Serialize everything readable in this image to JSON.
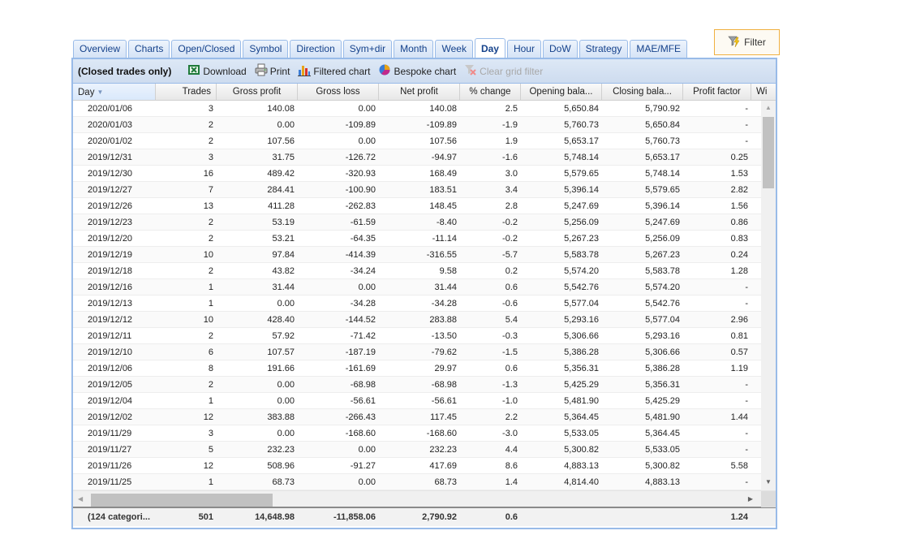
{
  "filter_button": {
    "label": "Filter",
    "icon": "funnel-lightning-icon"
  },
  "tabs": [
    {
      "label": "Overview",
      "active": false
    },
    {
      "label": "Charts",
      "active": false
    },
    {
      "label": "Open/Closed",
      "active": false
    },
    {
      "label": "Symbol",
      "active": false
    },
    {
      "label": "Direction",
      "active": false
    },
    {
      "label": "Sym+dir",
      "active": false
    },
    {
      "label": "Month",
      "active": false
    },
    {
      "label": "Week",
      "active": false
    },
    {
      "label": "Day",
      "active": true
    },
    {
      "label": "Hour",
      "active": false
    },
    {
      "label": "DoW",
      "active": false
    },
    {
      "label": "Strategy",
      "active": false
    },
    {
      "label": "MAE/MFE",
      "active": false
    }
  ],
  "toolbar": {
    "title": "(Closed trades only)",
    "download": "Download",
    "print": "Print",
    "filtered_chart": "Filtered chart",
    "bespoke_chart": "Bespoke chart",
    "clear_filter": "Clear grid filter"
  },
  "columns": [
    "Day",
    "Trades",
    "Gross profit",
    "Gross loss",
    "Net profit",
    "% change",
    "Opening bala...",
    "Closing bala...",
    "Profit factor",
    "Wi"
  ],
  "sort": {
    "column": "Day",
    "direction": "desc"
  },
  "rows": [
    [
      "2020/01/06",
      "3",
      "140.08",
      "0.00",
      "140.08",
      "2.5",
      "5,650.84",
      "5,790.92",
      "-"
    ],
    [
      "2020/01/03",
      "2",
      "0.00",
      "-109.89",
      "-109.89",
      "-1.9",
      "5,760.73",
      "5,650.84",
      "-"
    ],
    [
      "2020/01/02",
      "2",
      "107.56",
      "0.00",
      "107.56",
      "1.9",
      "5,653.17",
      "5,760.73",
      "-"
    ],
    [
      "2019/12/31",
      "3",
      "31.75",
      "-126.72",
      "-94.97",
      "-1.6",
      "5,748.14",
      "5,653.17",
      "0.25"
    ],
    [
      "2019/12/30",
      "16",
      "489.42",
      "-320.93",
      "168.49",
      "3.0",
      "5,579.65",
      "5,748.14",
      "1.53"
    ],
    [
      "2019/12/27",
      "7",
      "284.41",
      "-100.90",
      "183.51",
      "3.4",
      "5,396.14",
      "5,579.65",
      "2.82"
    ],
    [
      "2019/12/26",
      "13",
      "411.28",
      "-262.83",
      "148.45",
      "2.8",
      "5,247.69",
      "5,396.14",
      "1.56"
    ],
    [
      "2019/12/23",
      "2",
      "53.19",
      "-61.59",
      "-8.40",
      "-0.2",
      "5,256.09",
      "5,247.69",
      "0.86"
    ],
    [
      "2019/12/20",
      "2",
      "53.21",
      "-64.35",
      "-11.14",
      "-0.2",
      "5,267.23",
      "5,256.09",
      "0.83"
    ],
    [
      "2019/12/19",
      "10",
      "97.84",
      "-414.39",
      "-316.55",
      "-5.7",
      "5,583.78",
      "5,267.23",
      "0.24"
    ],
    [
      "2019/12/18",
      "2",
      "43.82",
      "-34.24",
      "9.58",
      "0.2",
      "5,574.20",
      "5,583.78",
      "1.28"
    ],
    [
      "2019/12/16",
      "1",
      "31.44",
      "0.00",
      "31.44",
      "0.6",
      "5,542.76",
      "5,574.20",
      "-"
    ],
    [
      "2019/12/13",
      "1",
      "0.00",
      "-34.28",
      "-34.28",
      "-0.6",
      "5,577.04",
      "5,542.76",
      "-"
    ],
    [
      "2019/12/12",
      "10",
      "428.40",
      "-144.52",
      "283.88",
      "5.4",
      "5,293.16",
      "5,577.04",
      "2.96"
    ],
    [
      "2019/12/11",
      "2",
      "57.92",
      "-71.42",
      "-13.50",
      "-0.3",
      "5,306.66",
      "5,293.16",
      "0.81"
    ],
    [
      "2019/12/10",
      "6",
      "107.57",
      "-187.19",
      "-79.62",
      "-1.5",
      "5,386.28",
      "5,306.66",
      "0.57"
    ],
    [
      "2019/12/06",
      "8",
      "191.66",
      "-161.69",
      "29.97",
      "0.6",
      "5,356.31",
      "5,386.28",
      "1.19"
    ],
    [
      "2019/12/05",
      "2",
      "0.00",
      "-68.98",
      "-68.98",
      "-1.3",
      "5,425.29",
      "5,356.31",
      "-"
    ],
    [
      "2019/12/04",
      "1",
      "0.00",
      "-56.61",
      "-56.61",
      "-1.0",
      "5,481.90",
      "5,425.29",
      "-"
    ],
    [
      "2019/12/02",
      "12",
      "383.88",
      "-266.43",
      "117.45",
      "2.2",
      "5,364.45",
      "5,481.90",
      "1.44"
    ],
    [
      "2019/11/29",
      "3",
      "0.00",
      "-168.60",
      "-168.60",
      "-3.0",
      "5,533.05",
      "5,364.45",
      "-"
    ],
    [
      "2019/11/27",
      "5",
      "232.23",
      "0.00",
      "232.23",
      "4.4",
      "5,300.82",
      "5,533.05",
      "-"
    ],
    [
      "2019/11/26",
      "12",
      "508.96",
      "-91.27",
      "417.69",
      "8.6",
      "4,883.13",
      "5,300.82",
      "5.58"
    ],
    [
      "2019/11/25",
      "1",
      "68.73",
      "0.00",
      "68.73",
      "1.4",
      "4,814.40",
      "4,883.13",
      "-"
    ]
  ],
  "summary": [
    "(124 categori...",
    "501",
    "14,648.98",
    "-11,858.06",
    "2,790.92",
    "0.6",
    "",
    "",
    "1.24"
  ],
  "colors": {
    "accent_border": "#99bbe8",
    "tab_text": "#15428b",
    "filter_border": "#f0b040"
  }
}
